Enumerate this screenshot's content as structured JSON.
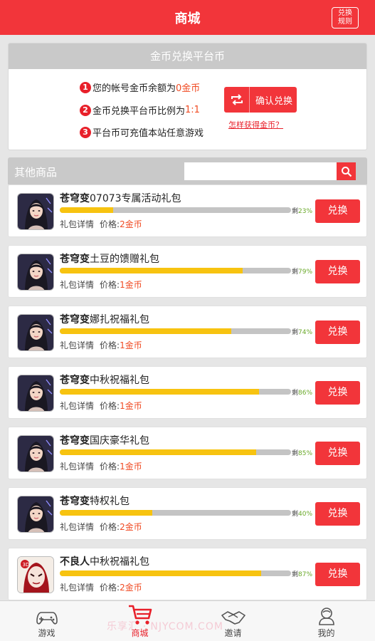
{
  "header": {
    "title": "商城",
    "rules_button": "兑换\n规则"
  },
  "exchange": {
    "title": "金币兑换平台币",
    "lines": [
      {
        "num": "1",
        "prefix": "您的帐号金币余额为",
        "highlight": "0金币",
        "suffix": ""
      },
      {
        "num": "2",
        "prefix": "金币兑换平台币比例为",
        "highlight": "1:1",
        "suffix": ""
      },
      {
        "num": "3",
        "prefix": "平台币可充值本站任意游戏",
        "highlight": "",
        "suffix": ""
      }
    ],
    "confirm_label": "确认兑换",
    "how_link": "怎样获得金币？"
  },
  "other": {
    "title": "其他商品",
    "search_placeholder": ""
  },
  "items": [
    {
      "game": "苍穹变",
      "name": "07073专属活动礼包",
      "remain_label": "剩",
      "pct": "23%",
      "progress": 0.23,
      "detail": "礼包详情",
      "price_label": "价格:",
      "price": "2金币",
      "button": "兑换",
      "thumb": "portrait"
    },
    {
      "game": "苍穹变",
      "name": "土豆的馈赠礼包",
      "remain_label": "剩",
      "pct": "79%",
      "progress": 0.79,
      "detail": "礼包详情",
      "price_label": "价格:",
      "price": "1金币",
      "button": "兑换",
      "thumb": "portrait"
    },
    {
      "game": "苍穹变",
      "name": "娜扎祝福礼包",
      "remain_label": "剩",
      "pct": "74%",
      "progress": 0.74,
      "detail": "礼包详情",
      "price_label": "价格:",
      "price": "1金币",
      "button": "兑换",
      "thumb": "portrait"
    },
    {
      "game": "苍穹变",
      "name": "中秋祝福礼包",
      "remain_label": "剩",
      "pct": "86%",
      "progress": 0.86,
      "detail": "礼包详情",
      "price_label": "价格:",
      "price": "1金币",
      "button": "兑换",
      "thumb": "portrait"
    },
    {
      "game": "苍穹变",
      "name": "国庆豪华礼包",
      "remain_label": "剩",
      "pct": "85%",
      "progress": 0.85,
      "detail": "礼包详情",
      "price_label": "价格:",
      "price": "1金币",
      "button": "兑换",
      "thumb": "portrait"
    },
    {
      "game": "苍穹变",
      "name": "特权礼包",
      "remain_label": "剩",
      "pct": "40%",
      "progress": 0.4,
      "detail": "礼包详情",
      "price_label": "价格:",
      "price": "2金币",
      "button": "兑换",
      "thumb": "portrait"
    },
    {
      "game": "不良人",
      "name": "中秋祝福礼包",
      "remain_label": "剩",
      "pct": "87%",
      "progress": 0.87,
      "detail": "礼包详情",
      "price_label": "价格:",
      "price": "2金币",
      "button": "兑换",
      "thumb": "mask"
    }
  ],
  "tabs": [
    {
      "label": "游戏",
      "icon": "gamepad-icon",
      "active": false
    },
    {
      "label": "商城",
      "icon": "cart-icon",
      "active": true
    },
    {
      "label": "邀请",
      "icon": "handshake-icon",
      "active": false
    },
    {
      "label": "我的",
      "icon": "user-icon",
      "active": false
    }
  ],
  "watermark": "乐享汇 · NJYCOM.COM",
  "colors": {
    "brand": "#f2353a",
    "progress": "#f7c310",
    "header_gray": "#c9c9c9",
    "pct_green": "#6aa92a",
    "price_red": "#f04a22"
  }
}
